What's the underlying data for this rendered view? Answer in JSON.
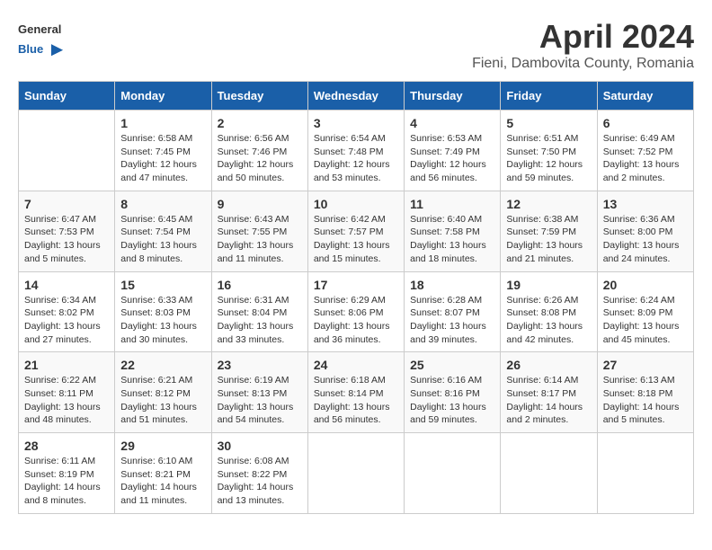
{
  "header": {
    "title": "April 2024",
    "subtitle": "Fieni, Dambovita County, Romania",
    "logo_general": "General",
    "logo_blue": "Blue"
  },
  "weekdays": [
    "Sunday",
    "Monday",
    "Tuesday",
    "Wednesday",
    "Thursday",
    "Friday",
    "Saturday"
  ],
  "weeks": [
    [
      {
        "day": "",
        "info": ""
      },
      {
        "day": "1",
        "info": "Sunrise: 6:58 AM\nSunset: 7:45 PM\nDaylight: 12 hours\nand 47 minutes."
      },
      {
        "day": "2",
        "info": "Sunrise: 6:56 AM\nSunset: 7:46 PM\nDaylight: 12 hours\nand 50 minutes."
      },
      {
        "day": "3",
        "info": "Sunrise: 6:54 AM\nSunset: 7:48 PM\nDaylight: 12 hours\nand 53 minutes."
      },
      {
        "day": "4",
        "info": "Sunrise: 6:53 AM\nSunset: 7:49 PM\nDaylight: 12 hours\nand 56 minutes."
      },
      {
        "day": "5",
        "info": "Sunrise: 6:51 AM\nSunset: 7:50 PM\nDaylight: 12 hours\nand 59 minutes."
      },
      {
        "day": "6",
        "info": "Sunrise: 6:49 AM\nSunset: 7:52 PM\nDaylight: 13 hours\nand 2 minutes."
      }
    ],
    [
      {
        "day": "7",
        "info": "Sunrise: 6:47 AM\nSunset: 7:53 PM\nDaylight: 13 hours\nand 5 minutes."
      },
      {
        "day": "8",
        "info": "Sunrise: 6:45 AM\nSunset: 7:54 PM\nDaylight: 13 hours\nand 8 minutes."
      },
      {
        "day": "9",
        "info": "Sunrise: 6:43 AM\nSunset: 7:55 PM\nDaylight: 13 hours\nand 11 minutes."
      },
      {
        "day": "10",
        "info": "Sunrise: 6:42 AM\nSunset: 7:57 PM\nDaylight: 13 hours\nand 15 minutes."
      },
      {
        "day": "11",
        "info": "Sunrise: 6:40 AM\nSunset: 7:58 PM\nDaylight: 13 hours\nand 18 minutes."
      },
      {
        "day": "12",
        "info": "Sunrise: 6:38 AM\nSunset: 7:59 PM\nDaylight: 13 hours\nand 21 minutes."
      },
      {
        "day": "13",
        "info": "Sunrise: 6:36 AM\nSunset: 8:00 PM\nDaylight: 13 hours\nand 24 minutes."
      }
    ],
    [
      {
        "day": "14",
        "info": "Sunrise: 6:34 AM\nSunset: 8:02 PM\nDaylight: 13 hours\nand 27 minutes."
      },
      {
        "day": "15",
        "info": "Sunrise: 6:33 AM\nSunset: 8:03 PM\nDaylight: 13 hours\nand 30 minutes."
      },
      {
        "day": "16",
        "info": "Sunrise: 6:31 AM\nSunset: 8:04 PM\nDaylight: 13 hours\nand 33 minutes."
      },
      {
        "day": "17",
        "info": "Sunrise: 6:29 AM\nSunset: 8:06 PM\nDaylight: 13 hours\nand 36 minutes."
      },
      {
        "day": "18",
        "info": "Sunrise: 6:28 AM\nSunset: 8:07 PM\nDaylight: 13 hours\nand 39 minutes."
      },
      {
        "day": "19",
        "info": "Sunrise: 6:26 AM\nSunset: 8:08 PM\nDaylight: 13 hours\nand 42 minutes."
      },
      {
        "day": "20",
        "info": "Sunrise: 6:24 AM\nSunset: 8:09 PM\nDaylight: 13 hours\nand 45 minutes."
      }
    ],
    [
      {
        "day": "21",
        "info": "Sunrise: 6:22 AM\nSunset: 8:11 PM\nDaylight: 13 hours\nand 48 minutes."
      },
      {
        "day": "22",
        "info": "Sunrise: 6:21 AM\nSunset: 8:12 PM\nDaylight: 13 hours\nand 51 minutes."
      },
      {
        "day": "23",
        "info": "Sunrise: 6:19 AM\nSunset: 8:13 PM\nDaylight: 13 hours\nand 54 minutes."
      },
      {
        "day": "24",
        "info": "Sunrise: 6:18 AM\nSunset: 8:14 PM\nDaylight: 13 hours\nand 56 minutes."
      },
      {
        "day": "25",
        "info": "Sunrise: 6:16 AM\nSunset: 8:16 PM\nDaylight: 13 hours\nand 59 minutes."
      },
      {
        "day": "26",
        "info": "Sunrise: 6:14 AM\nSunset: 8:17 PM\nDaylight: 14 hours\nand 2 minutes."
      },
      {
        "day": "27",
        "info": "Sunrise: 6:13 AM\nSunset: 8:18 PM\nDaylight: 14 hours\nand 5 minutes."
      }
    ],
    [
      {
        "day": "28",
        "info": "Sunrise: 6:11 AM\nSunset: 8:19 PM\nDaylight: 14 hours\nand 8 minutes."
      },
      {
        "day": "29",
        "info": "Sunrise: 6:10 AM\nSunset: 8:21 PM\nDaylight: 14 hours\nand 11 minutes."
      },
      {
        "day": "30",
        "info": "Sunrise: 6:08 AM\nSunset: 8:22 PM\nDaylight: 14 hours\nand 13 minutes."
      },
      {
        "day": "",
        "info": ""
      },
      {
        "day": "",
        "info": ""
      },
      {
        "day": "",
        "info": ""
      },
      {
        "day": "",
        "info": ""
      }
    ]
  ]
}
